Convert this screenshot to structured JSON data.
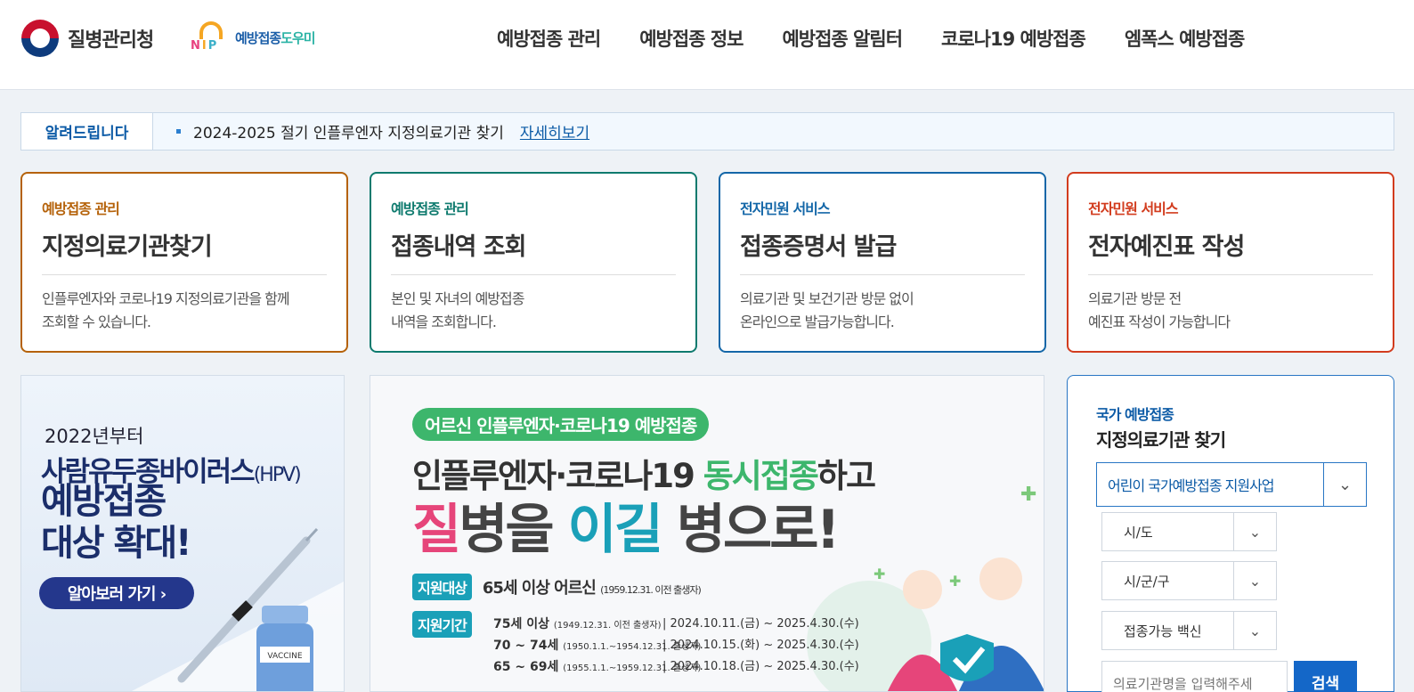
{
  "header": {
    "org_name": "질병관리청",
    "nip_letters": [
      "N",
      "I",
      "P"
    ],
    "nip_name_a": "예방접종",
    "nip_name_b": "도우미",
    "nav": [
      "예방접종 관리",
      "예방접종 정보",
      "예방접종 알림터",
      "코로나19 예방접종",
      "엠폭스 예방접종"
    ]
  },
  "notice": {
    "label": "알려드립니다",
    "text": "2024-2025 절기 인플루엔자 지정의료기관 찾기",
    "link": "자세히보기"
  },
  "cards": [
    {
      "category": "예방접종 관리",
      "title": "지정의료기관찾기",
      "desc": "인플루엔자와 코로나19 지정의료기관을 함께\n조회할 수 있습니다.",
      "color": "#b5620a"
    },
    {
      "category": "예방접종 관리",
      "title": "접종내역 조회",
      "desc": "본인 및 자녀의 예방접종\n내역을 조회합니다.",
      "color": "#0e7a6e"
    },
    {
      "category": "전자민원 서비스",
      "title": "접종증명서 발급",
      "desc": "의료기관 및 보건기관 방문 없이\n온라인으로 발급가능합니다.",
      "color": "#1467a8"
    },
    {
      "category": "전자민원 서비스",
      "title": "전자예진표 작성",
      "desc": "의료기관 방문 전\n예진표 작성이 가능합니다",
      "color": "#d23c1e"
    }
  ],
  "hpv_banner": {
    "year": "2022년부터",
    "headline": "사람유두종바이러스",
    "headline_suffix": "(HPV)",
    "headline2": "예방접종",
    "headline3": "대상 확대!",
    "button": "알아보러 가기 ›",
    "vial_label": "VACCINE"
  },
  "main_banner": {
    "pill": "어르신 인플루엔자·코로나19 예방접종",
    "line1_a": "인플루엔자·코로나19 ",
    "line1_b": "동시접종",
    "line1_c": "하고",
    "line2_a": "질",
    "line2_b": "병을 ",
    "line2_c": "이길",
    "line2_d": " 병으로!",
    "target_tag": "지원대상",
    "target_value": "65세 이상 어르신",
    "target_note": "(1959.12.31. 이전 출생자)",
    "period_tag": "지원기간",
    "periods": [
      {
        "age": "75세 이상",
        "note": "(1949.12.31. 이전 출생자)",
        "range": "| 2024.10.11.(금) ~ 2025.4.30.(수)"
      },
      {
        "age": "70 ~ 74세",
        "note": "(1950.1.1.~1954.12.31. 출생자)",
        "range": "| 2024.10.15.(화) ~ 2025.4.30.(수)"
      },
      {
        "age": "65 ~ 69세",
        "note": "(1955.1.1.~1959.12.31. 출생자)",
        "range": "| 2024.10.18.(금) ~ 2025.4.30.(수)"
      }
    ]
  },
  "finder": {
    "category": "국가 예방접종",
    "title": "지정의료기관 찾기",
    "program": "어린이 국가예방접종 지원사업",
    "sido": "시/도",
    "sigungu": "시/군/구",
    "vaccine": "접종가능 백신",
    "search_placeholder": "의료기관명을 입력해주세",
    "search_button": "검색"
  }
}
